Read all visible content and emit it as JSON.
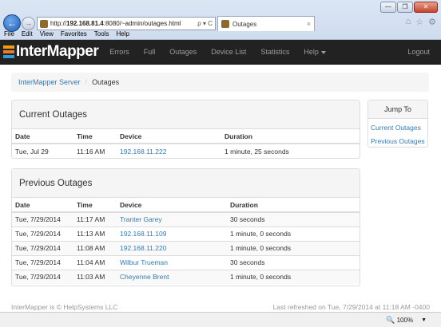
{
  "browser": {
    "url_prefix": "http://",
    "url_host": "192.168.81.4",
    "url_rest": ":8080/~admin/outages.html",
    "addr_tools": "ρ ▾ C",
    "tab_title": "Outages",
    "tab_close": "×",
    "window_buttons": {
      "minimize": "—",
      "restore": "❐",
      "close": "✕"
    },
    "back_glyph": "←",
    "forward_glyph": "→",
    "right_icons": [
      "⌂",
      "☆",
      "⚙"
    ],
    "menu": [
      "File",
      "Edit",
      "View",
      "Favorites",
      "Tools",
      "Help"
    ]
  },
  "navbar": {
    "brand": "InterMapper",
    "links": [
      "Errors",
      "Full",
      "Outages",
      "Device List",
      "Statistics"
    ],
    "help_label": "Help",
    "logout_label": "Logout"
  },
  "breadcrumb": {
    "home": "InterMapper Server",
    "separator": "/",
    "current": "Outages"
  },
  "current_outages": {
    "title": "Current Outages",
    "columns": [
      "Date",
      "Time",
      "Device",
      "Duration"
    ],
    "rows": [
      {
        "date": "Tue, Jul 29",
        "time": "11:16 AM",
        "device": "192.168.11.222",
        "duration": "1 minute, 25 seconds"
      }
    ]
  },
  "previous_outages": {
    "title": "Previous Outages",
    "columns": [
      "Date",
      "Time",
      "Device",
      "Duration"
    ],
    "rows": [
      {
        "date": "Tue, 7/29/2014",
        "time": "11:17 AM",
        "device": "Tranter Garey",
        "duration": "30 seconds"
      },
      {
        "date": "Tue, 7/29/2014",
        "time": "11:13 AM",
        "device": "192.168.11.109",
        "duration": "1 minute, 0 seconds"
      },
      {
        "date": "Tue, 7/29/2014",
        "time": "11:08 AM",
        "device": "192.168.11.220",
        "duration": "1 minute, 0 seconds"
      },
      {
        "date": "Tue, 7/29/2014",
        "time": "11:04 AM",
        "device": "Wilbur Trueman",
        "duration": "30 seconds"
      },
      {
        "date": "Tue, 7/29/2014",
        "time": "11:03 AM",
        "device": "Cheyenne Brent",
        "duration": "1 minute, 0 seconds"
      }
    ]
  },
  "jump_to": {
    "title": "Jump To",
    "links": [
      "Current Outages",
      "Previous Outages"
    ]
  },
  "footer": {
    "copyright": "InterMapper is © HelpSystems LLC",
    "refreshed": "Last refreshed on Tue, 7/29/2014 at 11:18 AM -0400"
  },
  "status": {
    "zoom": "100%",
    "zoom_icon": "🔍",
    "zoom_caret": "▼"
  },
  "colors": {
    "navbar_bg": "#222222",
    "link": "#337ab7",
    "panel_heading_bg": "#f5f5f5"
  }
}
